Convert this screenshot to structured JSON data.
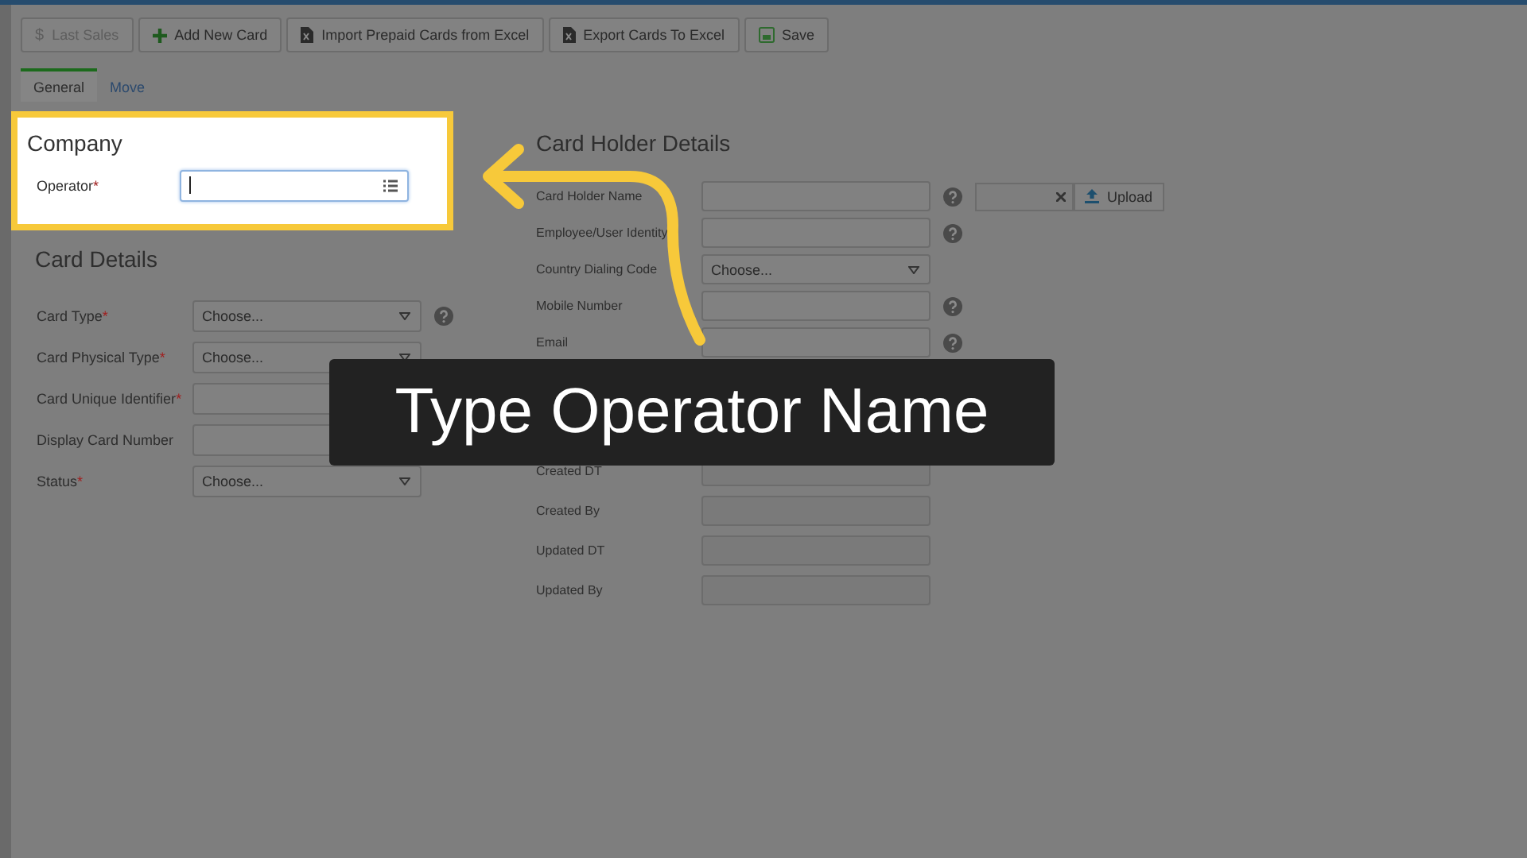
{
  "toolbar": [
    {
      "kind": "sales",
      "glyph": "$",
      "label": "Last Sales",
      "disabled": true
    },
    {
      "kind": "add",
      "label": "Add New Card",
      "disabled": false
    },
    {
      "kind": "import",
      "label": "Import Prepaid Cards from Excel",
      "disabled": false
    },
    {
      "kind": "export",
      "label": "Export Cards To Excel",
      "disabled": false
    },
    {
      "kind": "save",
      "label": "Save",
      "disabled": false
    }
  ],
  "tabs": [
    {
      "label": "General",
      "selected": true
    },
    {
      "label": "Move",
      "selected": false
    }
  ],
  "company": {
    "title": "Company",
    "fields": [
      {
        "label": "Operator",
        "mark": "*",
        "kind": "lookup",
        "focused": true
      }
    ]
  },
  "card_details": {
    "title": "Card Details",
    "fields": [
      {
        "label": "Card Type",
        "mark": "*",
        "kind": "select",
        "value": "Choose...",
        "help": true
      },
      {
        "label": "Card Physical Type",
        "mark": "*",
        "kind": "select",
        "value": "Choose...",
        "help": false
      },
      {
        "label": "Card Unique Identifier",
        "mark": "*",
        "kind": "text"
      },
      {
        "label": "Display Card Number",
        "kind": "text"
      },
      {
        "label": "Status",
        "mark": "*",
        "kind": "select",
        "value": "Choose...",
        "help": false
      }
    ]
  },
  "card_holder": {
    "title": "Card Holder Details",
    "upload": {
      "label": "Upload"
    },
    "fields": [
      {
        "label": "Card Holder Name",
        "kind": "text",
        "help": true
      },
      {
        "label": "Employee/User Identity",
        "kind": "text",
        "help": true
      },
      {
        "label": "Country Dialing Code",
        "kind": "select",
        "value": "Choose...",
        "help": false
      },
      {
        "label": "Mobile Number",
        "kind": "text",
        "help": true
      },
      {
        "label": "Email",
        "kind": "text",
        "help": true
      }
    ]
  },
  "misc": {
    "fields": [
      {
        "label": "Created DT"
      },
      {
        "label": "Created By"
      },
      {
        "label": "Updated DT"
      },
      {
        "label": "Updated By"
      }
    ]
  },
  "tutorial": {
    "caption": "Type Operator Name"
  }
}
